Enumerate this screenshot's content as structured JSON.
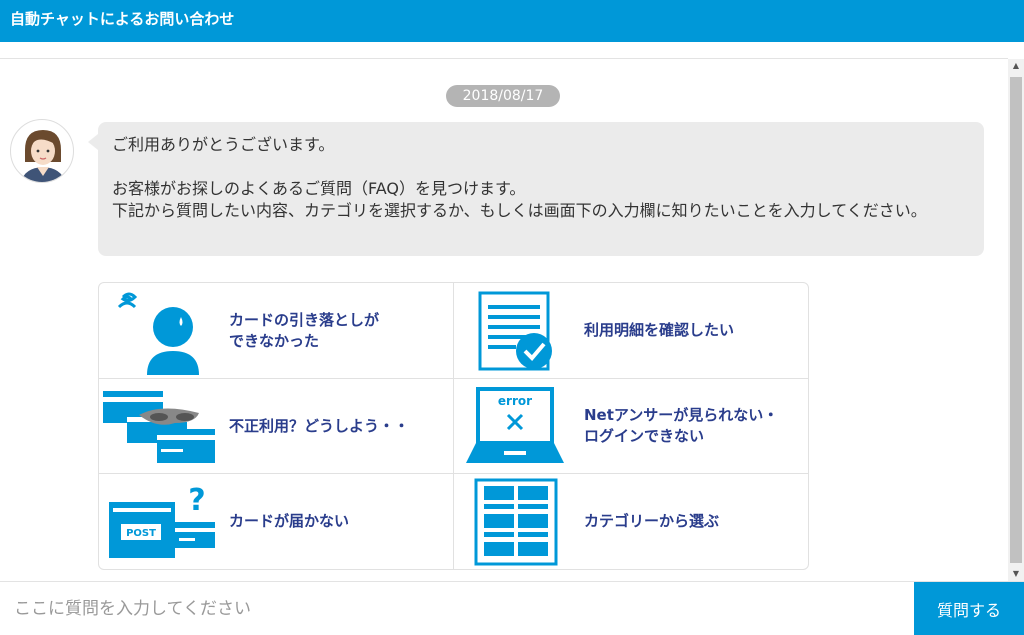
{
  "header": {
    "title": "自動チャットによるお問い合わせ"
  },
  "chat": {
    "date": "2018/08/17",
    "avatar_icon": "operator-avatar-icon",
    "bubble": {
      "line1": "ご利用ありがとうございます。",
      "line2": "お客様がお探しのよくあるご質問（FAQ）を見つけます。",
      "line3": "下記から質問したい内容、カテゴリを選択するか、もしくは画面下の入力欄に知りたいことを入力してください。"
    }
  },
  "faq_options": [
    {
      "label": "カードの引き落としが\nできなかった",
      "icon": "worried-person-icon"
    },
    {
      "label": "利用明細を確認したい",
      "icon": "statement-check-icon"
    },
    {
      "label": "不正利用？どうしよう・・",
      "icon": "card-fraud-icon"
    },
    {
      "label": "Netアンサーが見られない・\nログインできない",
      "icon": "laptop-error-icon"
    },
    {
      "label": "カードが届かない",
      "icon": "post-box-icon"
    },
    {
      "label": "カテゴリーから選ぶ",
      "icon": "category-list-icon"
    }
  ],
  "error_icon_text": "error",
  "post_icon_text": "POST",
  "input": {
    "placeholder": "ここに質問を入力してください",
    "value": ""
  },
  "send_button": {
    "label": "質問する"
  },
  "colors": {
    "brand": "#0098d8",
    "label_text": "#2a3d8c",
    "bubble_bg": "#ebebeb",
    "date_pill": "#b4b4b4"
  }
}
